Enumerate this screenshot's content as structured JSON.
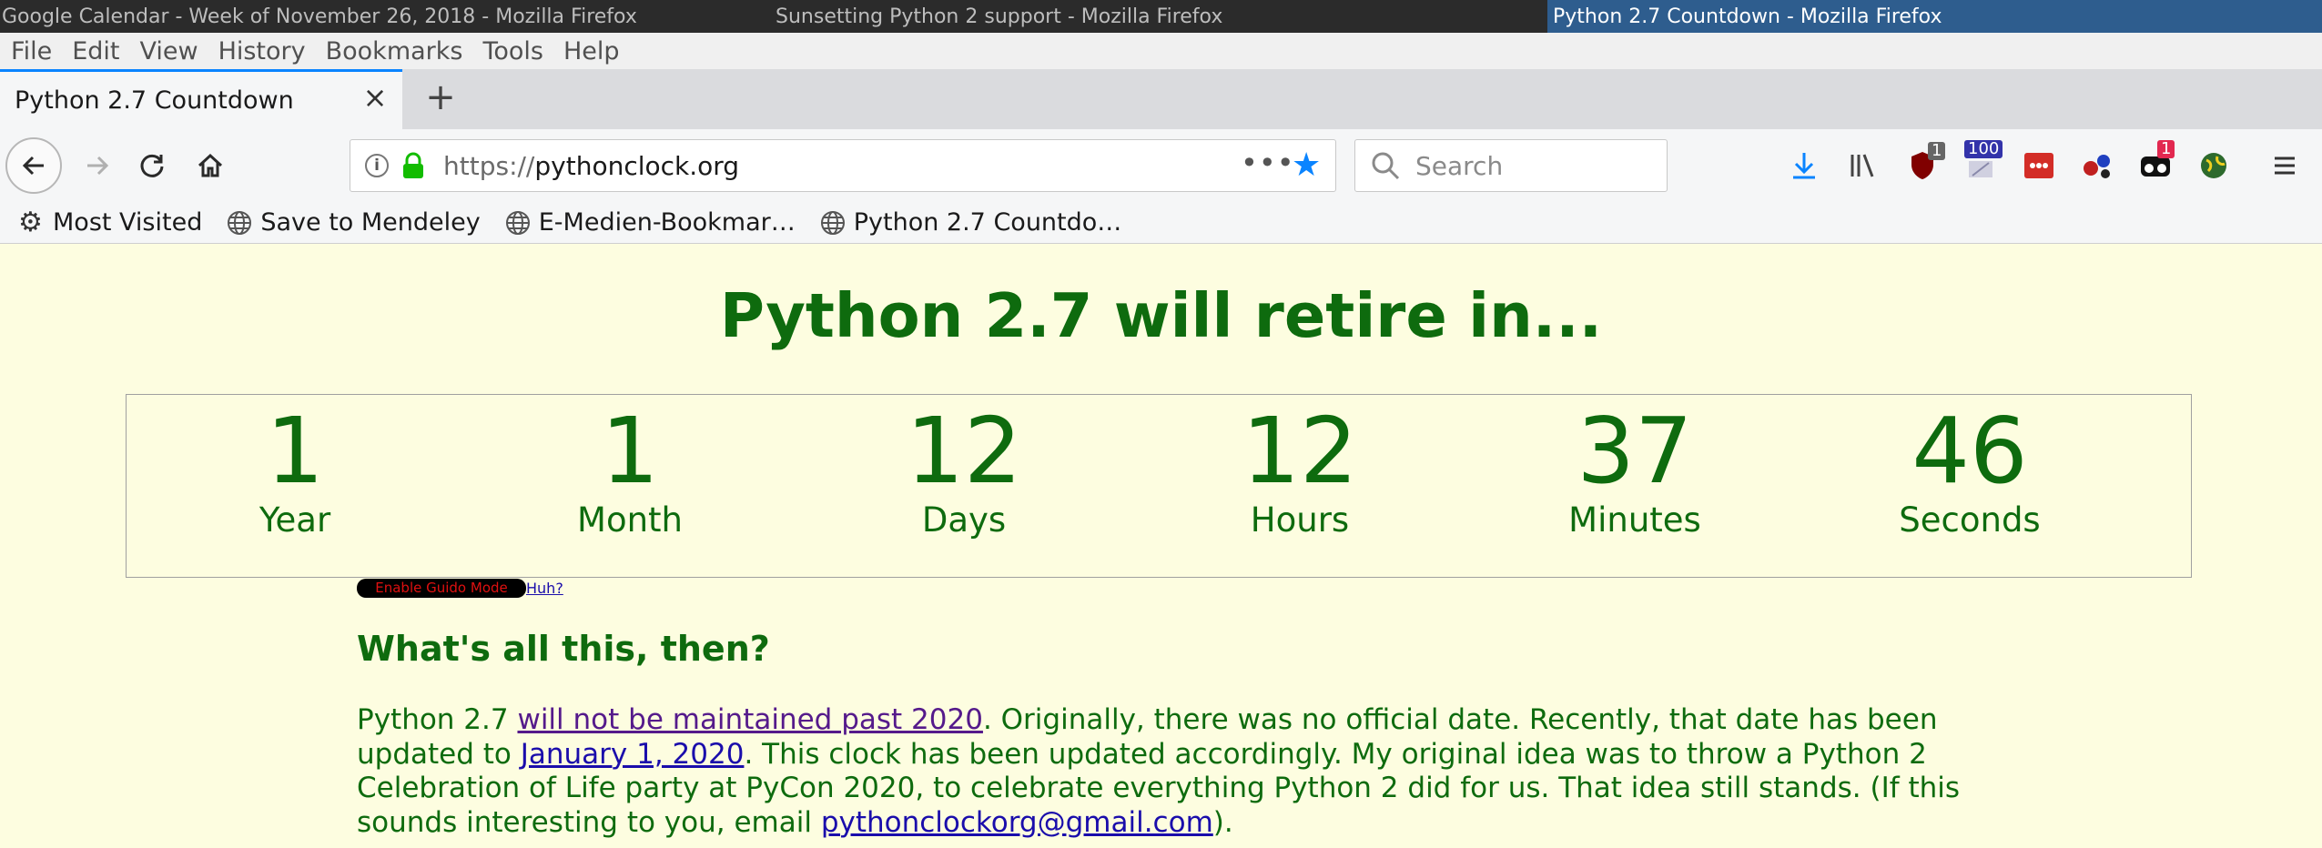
{
  "window_titles": [
    "Google Calendar - Week of November 26, 2018 - Mozilla Firefox",
    "Sunsetting Python 2 support - Mozilla Firefox",
    "Python 2.7 Countdown - Mozilla Firefox"
  ],
  "menu": [
    "File",
    "Edit",
    "View",
    "History",
    "Bookmarks",
    "Tools",
    "Help"
  ],
  "tab": {
    "title": "Python 2.7 Countdown",
    "close": "×",
    "new_tab": "+"
  },
  "url": {
    "scheme": "https://",
    "host": "pythonclock.org",
    "more": "•••"
  },
  "search": {
    "placeholder": "Search"
  },
  "toolbar_badges": {
    "ublock": "1",
    "counter": "100",
    "extension": "1"
  },
  "bookmarks": [
    "Most Visited",
    "Save to Mendeley",
    "E-Medien-Bookmar…",
    "Python 2.7 Countdo…"
  ],
  "page": {
    "headline": "Python 2.7 will retire in...",
    "countdown": [
      {
        "value": "1",
        "label": "Year"
      },
      {
        "value": "1",
        "label": "Month"
      },
      {
        "value": "12",
        "label": "Days"
      },
      {
        "value": "12",
        "label": "Hours"
      },
      {
        "value": "37",
        "label": "Minutes"
      },
      {
        "value": "46",
        "label": "Seconds"
      }
    ],
    "guido_button": "Enable Guido Mode",
    "huh_link": "Huh?",
    "about_heading": "What's all this, then?",
    "about": {
      "p1": "Python 2.7 ",
      "link1": "will not be maintained past 2020",
      "p2": ". Originally, there was no official date. Recently, that date has been updated to ",
      "link2": "January 1, 2020",
      "p3": ". This clock has been updated accordingly. My original idea was to throw a Python 2 Celebration of Life party at PyCon 2020, to celebrate everything Python 2 did for us. That idea still stands. (If this sounds interesting to you, email ",
      "link3": "pythonclockorg@gmail.com",
      "p4": ")."
    }
  },
  "colors": {
    "page_bg": "#fdfde0",
    "text_green": "#0e6b0e",
    "accent_blue": "#0a84ff"
  }
}
